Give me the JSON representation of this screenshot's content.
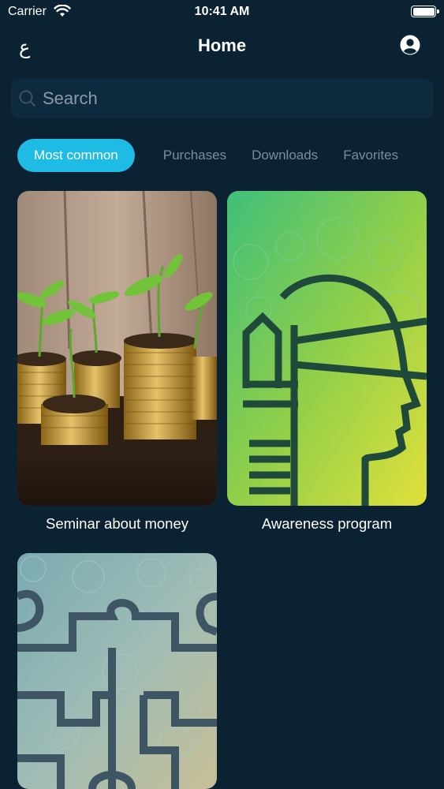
{
  "status_bar": {
    "carrier": "Carrier",
    "time": "10:41 AM"
  },
  "nav": {
    "lang_toggle": "ع",
    "title": "Home"
  },
  "search": {
    "placeholder": "Search"
  },
  "tabs": [
    {
      "label": "Most common",
      "active": true
    },
    {
      "label": "Purchases",
      "active": false
    },
    {
      "label": "Downloads",
      "active": false
    },
    {
      "label": "Favorites",
      "active": false
    }
  ],
  "cards": [
    {
      "title": "Seminar about money",
      "image": "coins-with-seedlings"
    },
    {
      "title": "Awareness program",
      "image": "head-profile-green"
    },
    {
      "title": "",
      "image": "puzzle-pattern"
    }
  ],
  "colors": {
    "background": "#0b2233",
    "accent": "#1ebbe5",
    "inactive_tab": "#7c8c99",
    "search_bg": "#0e2a3e"
  }
}
